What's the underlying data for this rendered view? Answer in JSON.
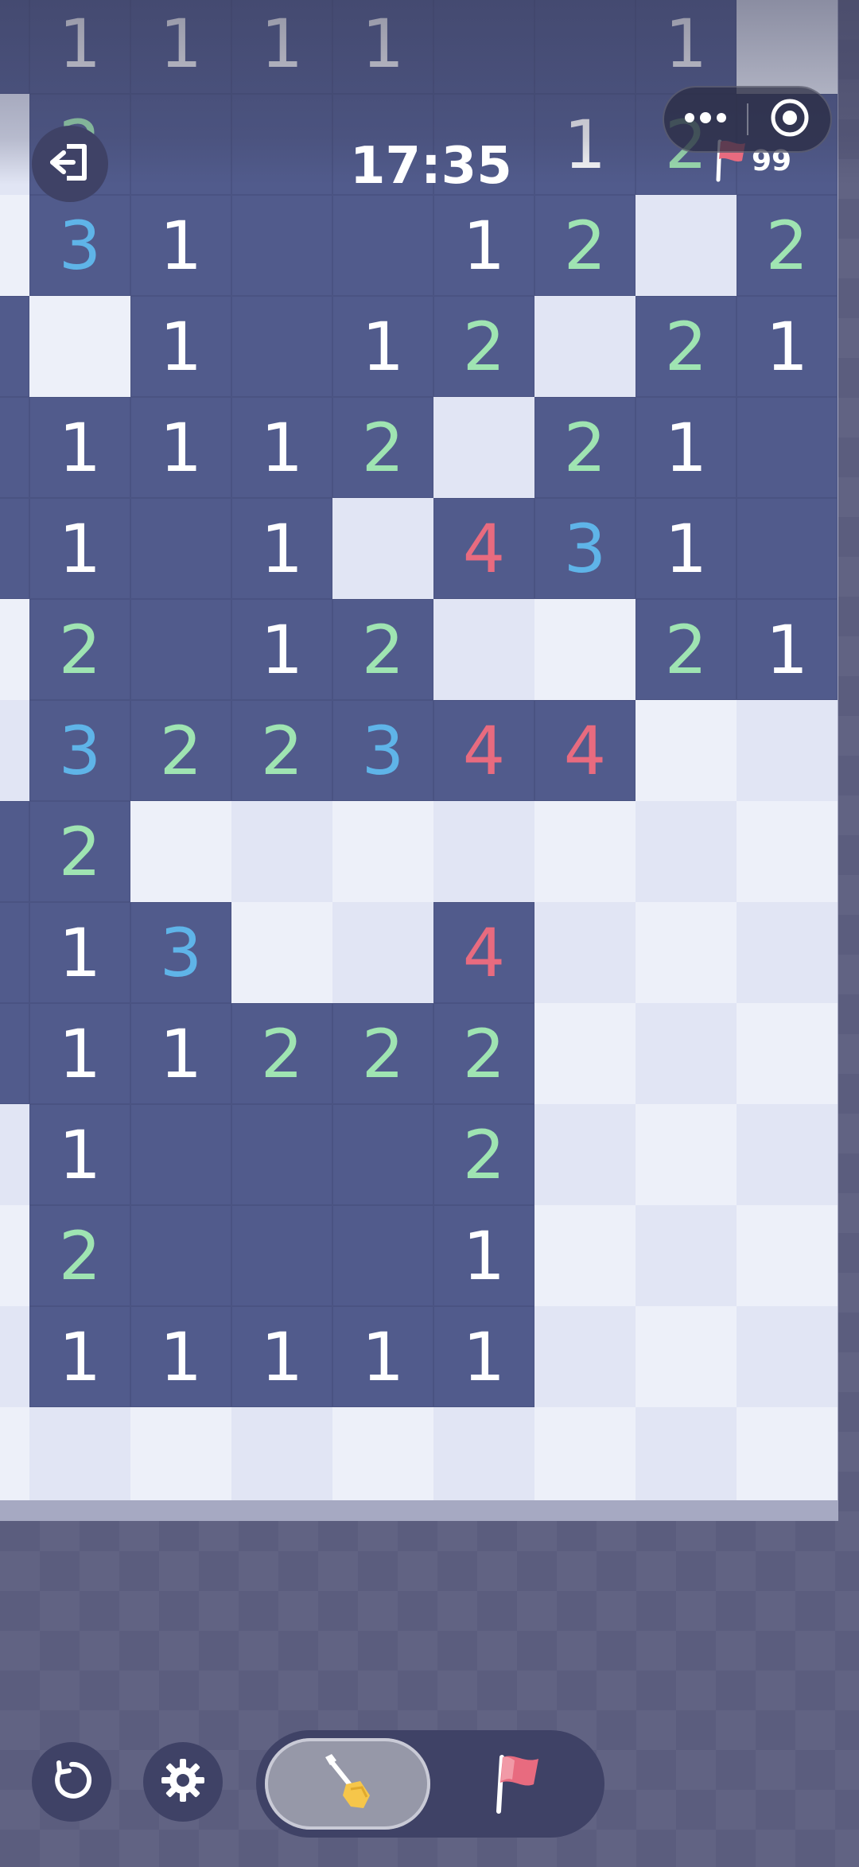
{
  "header": {
    "timer": "17:35",
    "flag_count": "99",
    "exit_icon": "exit-icon",
    "more_icon": "more-dots-icon",
    "close_icon": "target-close-icon"
  },
  "board": {
    "columns": 9,
    "visible_rows": 15,
    "rows": [
      [
        "R",
        "1",
        "1",
        "1",
        "1",
        "R",
        "R",
        "1",
        "C"
      ],
      [
        "C",
        "2",
        "R",
        "R",
        "R",
        "R",
        "1",
        "2",
        "R"
      ],
      [
        "C",
        "3",
        "1",
        "R",
        "R",
        "1",
        "2",
        "C",
        "2"
      ],
      [
        "R",
        "C",
        "1",
        "R",
        "1",
        "2",
        "C",
        "2",
        "1"
      ],
      [
        "R",
        "1",
        "1",
        "1",
        "2",
        "C",
        "2",
        "1",
        "R"
      ],
      [
        "R",
        "1",
        "R",
        "1",
        "C",
        "4",
        "3",
        "1",
        "R"
      ],
      [
        "C",
        "2",
        "R",
        "1",
        "2",
        "C",
        "C",
        "2",
        "1"
      ],
      [
        "C",
        "3",
        "2",
        "2",
        "3",
        "4",
        "4",
        "C",
        "C"
      ],
      [
        "R",
        "2",
        "C",
        "C",
        "C",
        "C",
        "C",
        "C",
        "C"
      ],
      [
        "R",
        "1",
        "3",
        "C",
        "C",
        "4",
        "C",
        "C",
        "C"
      ],
      [
        "R",
        "1",
        "1",
        "2",
        "2",
        "2",
        "C",
        "C",
        "C"
      ],
      [
        "C",
        "1",
        "R",
        "R",
        "R",
        "2",
        "C",
        "C",
        "C"
      ],
      [
        "C",
        "2",
        "R",
        "R",
        "R",
        "1",
        "C",
        "C",
        "C"
      ],
      [
        "C",
        "1",
        "1",
        "1",
        "1",
        "1",
        "C",
        "C",
        "C"
      ],
      [
        "C",
        "C",
        "C",
        "C",
        "C",
        "C",
        "C",
        "C",
        "C"
      ]
    ]
  },
  "controls": {
    "restart_icon": "restart-icon",
    "settings_icon": "gear-icon",
    "dig_icon": "shovel-icon",
    "flag_icon": "flag-icon",
    "selected_mode": "dig"
  },
  "colors": {
    "revealed": "#515b8c",
    "covered_light": "#edf0f9",
    "covered_alt": "#e1e5f4",
    "num1": "#ffffff",
    "num2": "#9fe4b2",
    "num3": "#5fb4e8",
    "num4": "#e86b7f",
    "flag": "#e86b7f"
  }
}
